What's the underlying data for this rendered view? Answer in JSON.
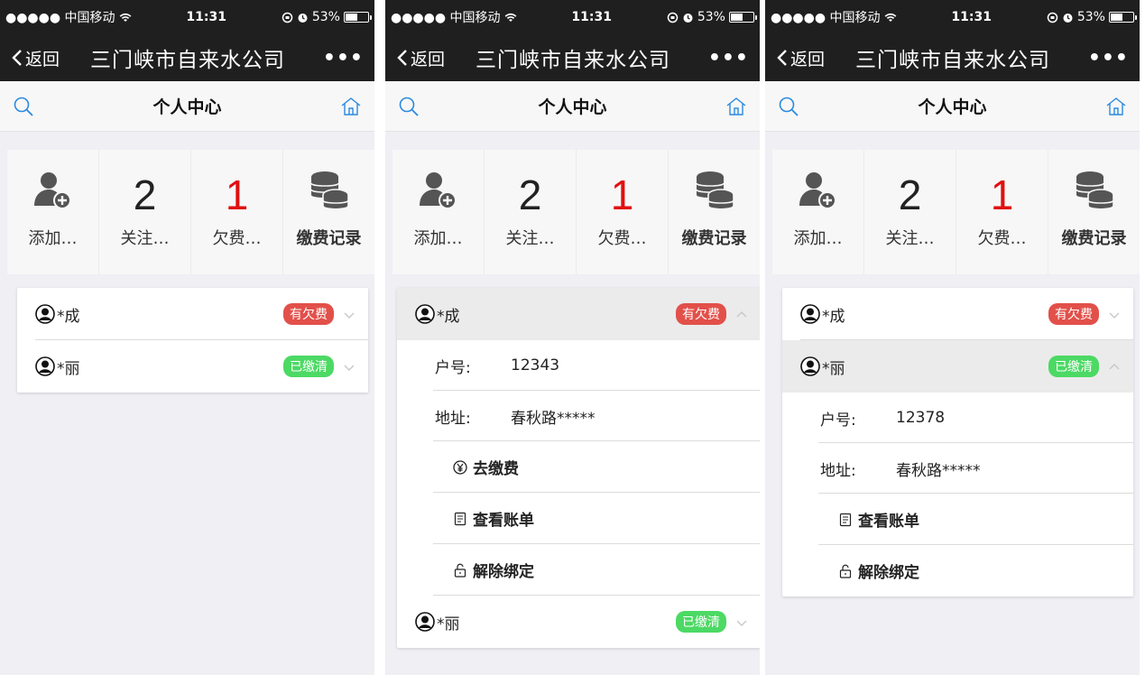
{
  "status_bar": {
    "carrier": "●●●●● 中国移动",
    "time": "11:31",
    "battery": "53%",
    "battery_level": 0.53
  },
  "nav": {
    "back_label": "返回",
    "title": "三门峡市自来水公司",
    "more": "•••"
  },
  "subheader": {
    "title": "个人中心"
  },
  "stats": {
    "add_label": "添加…",
    "follow_count": "2",
    "follow_label": "关注…",
    "owe_count": "1",
    "owe_label": "欠费…",
    "records_label": "缴费记录"
  },
  "accounts": [
    {
      "name": "*成",
      "status": "有欠费",
      "account_label": "户号:",
      "account_no": "12343",
      "address_label": "地址:",
      "address": "春秋路*****"
    },
    {
      "name": "*丽",
      "status": "已缴清",
      "account_label": "户号:",
      "account_no": "12378",
      "address_label": "地址:",
      "address": "春秋路*****"
    }
  ],
  "actions": {
    "pay": "去缴费",
    "bill": "查看账单",
    "unbind": "解除绑定"
  },
  "colors": {
    "owe_badge": "#e2504a",
    "paid_badge": "#4cd964",
    "accent_blue": "#2a8ae0",
    "red_count": "#e01010"
  }
}
